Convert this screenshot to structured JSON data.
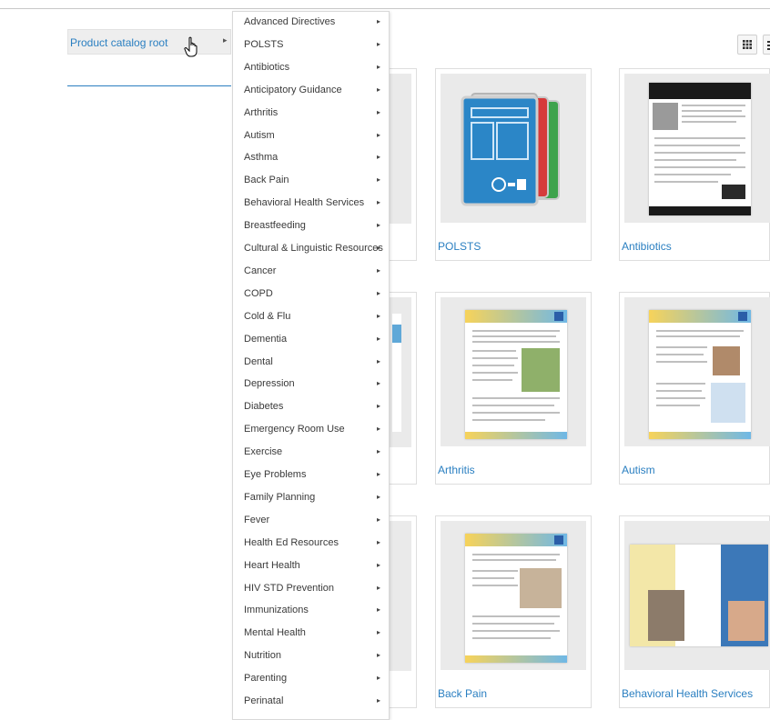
{
  "breadcrumb": {
    "root_label": "Product catalog root"
  },
  "menu": {
    "items": [
      "Advanced Directives",
      "POLSTS",
      "Antibiotics",
      "Anticipatory Guidance",
      "Arthritis",
      "Autism",
      "Asthma",
      "Back Pain",
      "Behavioral Health Services",
      "Breastfeeding",
      "Cultural & Linguistic Resources",
      "Cancer",
      "COPD",
      "Cold & Flu",
      "Dementia",
      "Dental",
      "Depression",
      "Diabetes",
      "Emergency Room Use",
      "Exercise",
      "Eye Problems",
      "Family Planning",
      "Fever",
      "Health Ed Resources",
      "Heart Health",
      "HIV STD Prevention",
      "Immunizations",
      "Mental Health",
      "Nutrition",
      "Parenting",
      "Perinatal"
    ]
  },
  "products": {
    "polsts": "POLSTS",
    "antibiotics": "Antibiotics",
    "arthritis": "Arthritis",
    "autism": "Autism",
    "back_pain": "Back Pain",
    "behavioral": "Behavioral Health Services"
  },
  "colors": {
    "link": "#2a7fc1",
    "accent_yellow": "#f7d35a",
    "accent_blue": "#6fb8e6"
  }
}
